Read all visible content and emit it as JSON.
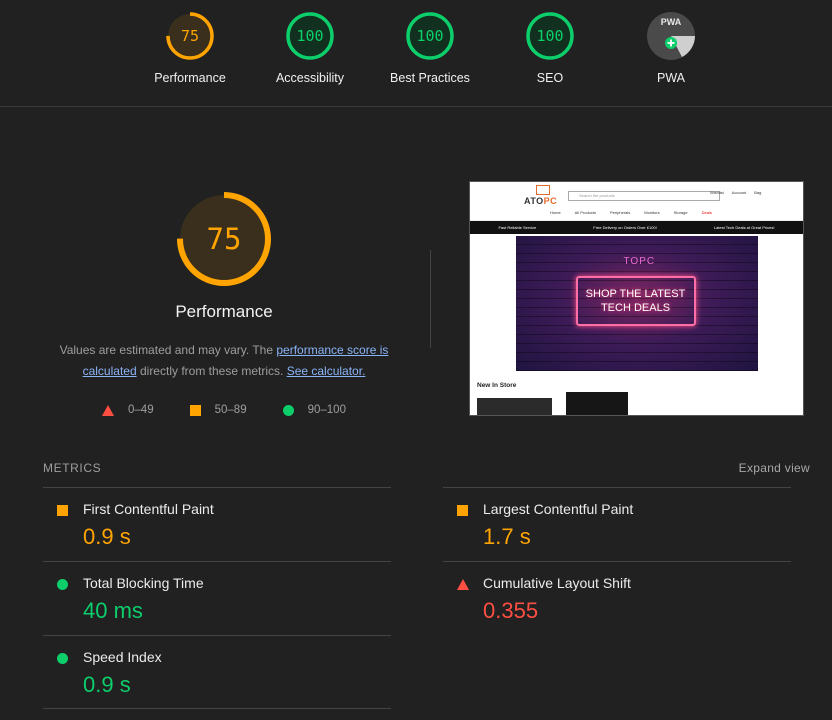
{
  "colors": {
    "orange": "#ffa400",
    "green": "#0cce6b",
    "red": "#ff4e42",
    "background": "#212121",
    "link": "#8ab4f8"
  },
  "gauges": [
    {
      "label": "Performance",
      "score": "75",
      "status": "average",
      "color": "#ffa400",
      "fraction": 0.75
    },
    {
      "label": "Accessibility",
      "score": "100",
      "status": "pass",
      "color": "#0cce6b",
      "fraction": 1.0
    },
    {
      "label": "Best Practices",
      "score": "100",
      "status": "pass",
      "color": "#0cce6b",
      "fraction": 1.0
    },
    {
      "label": "SEO",
      "score": "100",
      "status": "pass",
      "color": "#0cce6b",
      "fraction": 1.0
    },
    {
      "label": "PWA",
      "badge": "PWA",
      "icon": "pwa-badge-icon"
    }
  ],
  "main": {
    "score": "75",
    "score_fraction": 0.75,
    "title": "Performance",
    "desc_prefix": "Values are estimated and may vary. The ",
    "desc_link1": "performance score is calculated",
    "desc_middle": " directly from these metrics. ",
    "desc_link2": "See calculator.",
    "legend": [
      {
        "icon": "red-triangle-icon",
        "range": "0–49"
      },
      {
        "icon": "orange-square-icon",
        "range": "50–89"
      },
      {
        "icon": "green-circle-icon",
        "range": "90–100"
      }
    ]
  },
  "screenshot": {
    "logo_a": "ATO",
    "logo_b": "PC",
    "search_placeholder": "Search the products",
    "header_icons": [
      "Wishlist",
      "Account",
      "Bag"
    ],
    "nav": [
      "Home",
      "All Products",
      "Peripherals",
      "Monitors",
      "Storage",
      "Deals"
    ],
    "band": [
      "Fast Reliable Service",
      "Free Delivery on Orders Over £100!",
      "Latest Tech Deals at Great Prices!"
    ],
    "hero_brand": "TOPC",
    "hero_text": "SHOP THE LATEST TECH DEALS",
    "section_title": "New In Store"
  },
  "metrics": {
    "header": "METRICS",
    "expand_label": "Expand view",
    "items": [
      {
        "name": "First Contentful Paint",
        "value": "0.9 s",
        "status": "average",
        "icon": "orange-square-icon"
      },
      {
        "name": "Largest Contentful Paint",
        "value": "1.7 s",
        "status": "average",
        "icon": "orange-square-icon"
      },
      {
        "name": "Total Blocking Time",
        "value": "40 ms",
        "status": "pass",
        "icon": "green-circle-icon"
      },
      {
        "name": "Cumulative Layout Shift",
        "value": "0.355",
        "status": "fail",
        "icon": "red-triangle-icon"
      },
      {
        "name": "Speed Index",
        "value": "0.9 s",
        "status": "pass",
        "icon": "green-circle-icon"
      }
    ]
  }
}
